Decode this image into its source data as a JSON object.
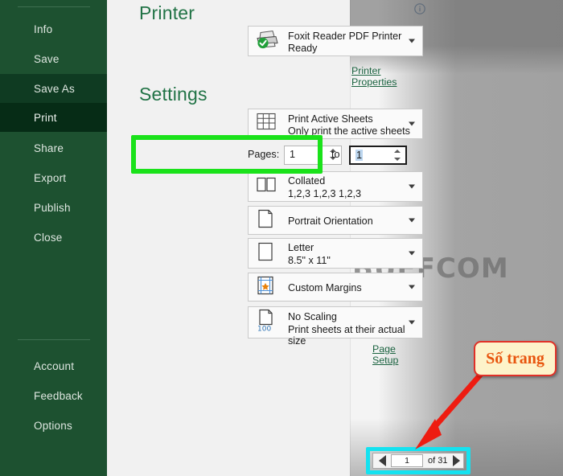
{
  "sidebar": {
    "items": [
      {
        "label": "Info",
        "state": "normal"
      },
      {
        "label": "Save",
        "state": "normal"
      },
      {
        "label": "Save As",
        "state": "hover"
      },
      {
        "label": "Print",
        "state": "selected"
      },
      {
        "label": "Share",
        "state": "normal"
      },
      {
        "label": "Export",
        "state": "normal"
      },
      {
        "label": "Publish",
        "state": "normal"
      },
      {
        "label": "Close",
        "state": "normal"
      }
    ],
    "bottom_items": [
      {
        "label": "Account"
      },
      {
        "label": "Feedback"
      },
      {
        "label": "Options"
      }
    ]
  },
  "printer": {
    "heading": "Printer",
    "name": "Foxit Reader PDF Printer",
    "status": "Ready",
    "properties_link": "Printer Properties",
    "icon": "printer-ready-icon",
    "info_icon": "info-icon"
  },
  "settings": {
    "heading": "Settings",
    "options": [
      {
        "icon": "worksheet-grid-icon",
        "title": "Print Active Sheets",
        "subtitle": "Only print the active sheets"
      },
      {
        "icon": "collated-pages-icon",
        "title": "Collated",
        "subtitle": "1,2,3   1,2,3   1,2,3"
      },
      {
        "icon": "portrait-page-icon",
        "title": "Portrait Orientation",
        "subtitle": ""
      },
      {
        "icon": "paper-size-icon",
        "title": "Letter",
        "subtitle": "8.5\" x 11\""
      },
      {
        "icon": "custom-margins-icon",
        "title": "Custom Margins",
        "subtitle": ""
      },
      {
        "icon": "no-scaling-icon",
        "title": "No Scaling",
        "subtitle": "Print sheets at their actual size"
      }
    ],
    "pages": {
      "label": "Pages:",
      "from_value": "1",
      "to_label": "to",
      "to_value": "1"
    },
    "page_setup_link": "Page Setup"
  },
  "preview": {
    "watermark_text": "BUFFCOM",
    "navigator": {
      "prev_icon": "previous-page-icon",
      "current_page": "1",
      "total_label": "of 31",
      "next_icon": "next-page-icon"
    }
  },
  "annotations": {
    "callout_text": "Số trang",
    "green_box_color": "#1ae21a",
    "cyan_box_color": "#14e2f0",
    "arrow_color": "#ee1c11",
    "callout_bg": "#fdf3ca",
    "callout_border": "#e03128",
    "callout_text_color": "#e8540d"
  }
}
